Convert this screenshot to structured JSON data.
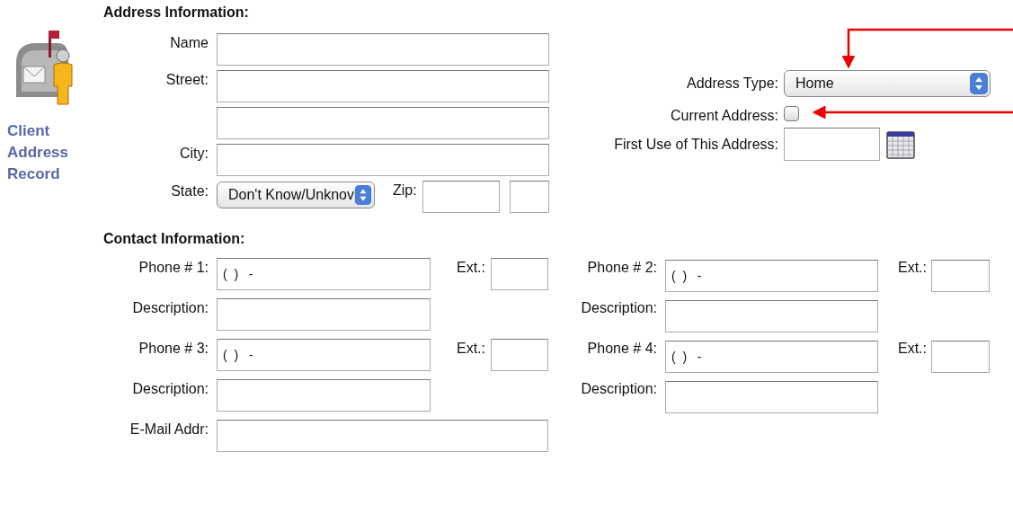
{
  "sidebar": {
    "title": "Client Address Record"
  },
  "address_information": {
    "heading": "Address Information:",
    "fields": [
      {
        "label": "Name",
        "kind": "single"
      },
      {
        "label": "Street:",
        "kind": "double"
      },
      {
        "label": "City:",
        "kind": "single"
      }
    ],
    "state": {
      "label": "State:",
      "value": "Don't Know/Unknov"
    },
    "zip": {
      "label": "Zip:"
    },
    "address_type": {
      "label": "Address Type:",
      "value": "Home"
    },
    "current_address": {
      "label": "Current Address:",
      "checked": false
    },
    "first_use": {
      "label": "First Use of This Address:"
    }
  },
  "contact_information": {
    "heading": "Contact Information:",
    "phones": [
      {
        "label": "Phone # 1:",
        "value": "(  )   -",
        "ext_label": "Ext.:",
        "description_label": "Description:"
      },
      {
        "label": "Phone # 2:",
        "value": "(  )   -",
        "ext_label": "Ext.:",
        "description_label": "Description:"
      },
      {
        "label": "Phone # 3:",
        "value": "(  )   -",
        "ext_label": "Ext.:",
        "description_label": "Description:"
      },
      {
        "label": "Phone # 4:",
        "value": "(  )   -",
        "ext_label": "Ext.:",
        "description_label": "Description:"
      }
    ],
    "email": {
      "label": "E-Mail Addr:"
    }
  }
}
